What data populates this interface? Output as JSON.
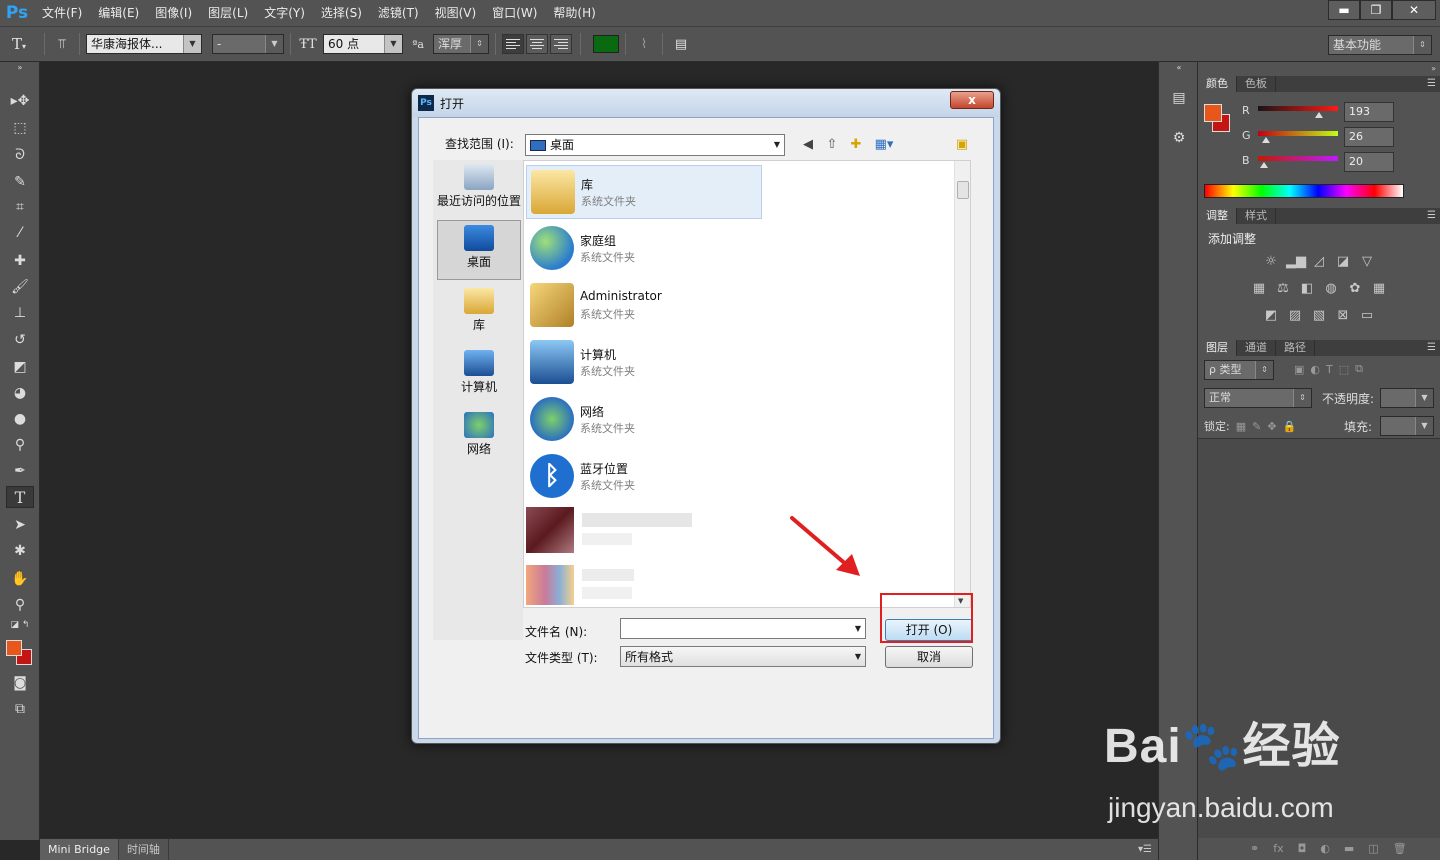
{
  "app": {
    "logo": "Ps"
  },
  "menu": [
    "文件(F)",
    "编辑(E)",
    "图像(I)",
    "图层(L)",
    "文字(Y)",
    "选择(S)",
    "滤镜(T)",
    "视图(V)",
    "窗口(W)",
    "帮助(H)"
  ],
  "window_controls": {
    "minimize": "▬",
    "restore": "❐",
    "close": "✕"
  },
  "options_bar": {
    "tool_glyph": "T",
    "font_family": "华康海报体...",
    "font_style": "-",
    "font_size": "60 点",
    "antialias_label": "ªa",
    "antialias": "浑厚",
    "text_color": "#0a6a10",
    "workspace": "基本功能"
  },
  "colors": {
    "foreground": "#e8561c",
    "background": "#c41414",
    "highlight": "#e02020"
  },
  "color_panel": {
    "tabs": [
      "颜色",
      "色板"
    ],
    "r": {
      "label": "R",
      "value": "193",
      "level": 0.757
    },
    "g": {
      "label": "G",
      "value": "26",
      "level": 0.102
    },
    "b": {
      "label": "B",
      "value": "20",
      "level": 0.078
    }
  },
  "adjust_panel": {
    "tabs": [
      "调整",
      "样式"
    ],
    "title": "添加调整"
  },
  "layers_panel": {
    "tabs": [
      "图层",
      "通道",
      "路径"
    ],
    "filter": "ρ 类型",
    "blend_mode": "正常",
    "opacity_label": "不透明度:",
    "lock_label": "锁定:",
    "fill_label": "填充:"
  },
  "bottom_tabs": [
    "Mini Bridge",
    "时间轴"
  ],
  "dialog": {
    "title": "打开",
    "close": "x",
    "lookin_label": "查找范围 (I):",
    "lookin_value": "桌面",
    "places": [
      {
        "label": "最近访问的位置",
        "icon": "recent-icon"
      },
      {
        "label": "桌面",
        "icon": "desktop-icon"
      },
      {
        "label": "库",
        "icon": "library-icon"
      },
      {
        "label": "计算机",
        "icon": "computer-icon"
      },
      {
        "label": "网络",
        "icon": "network-icon"
      }
    ],
    "files": [
      {
        "name": "库",
        "type": "系统文件夹",
        "icon": "library-folder-icon"
      },
      {
        "name": "家庭组",
        "type": "系统文件夹",
        "icon": "homegroup-icon"
      },
      {
        "name": "Administrator",
        "type": "系统文件夹",
        "icon": "user-folder-icon"
      },
      {
        "name": "计算机",
        "type": "系统文件夹",
        "icon": "computer-icon"
      },
      {
        "name": "网络",
        "type": "系统文件夹",
        "icon": "network-icon"
      },
      {
        "name": "蓝牙位置",
        "type": "系统文件夹",
        "icon": "bluetooth-icon"
      }
    ],
    "filename_label": "文件名 (N):",
    "filename_value": "",
    "filetype_label": "文件类型 (T):",
    "filetype_value": "所有格式",
    "open_button": "打开 (O)",
    "cancel_button": "取消"
  },
  "watermark": {
    "text": "Bai🐾经验",
    "url": "jingyan.baidu.com"
  }
}
